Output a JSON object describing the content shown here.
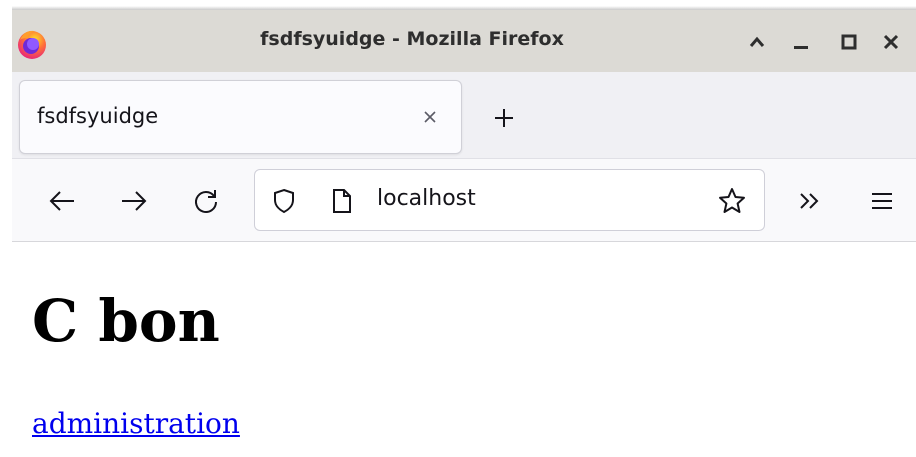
{
  "window": {
    "title": "fsdfsyuidge - Mozilla Firefox"
  },
  "tabs": [
    {
      "title": "fsdfsyuidge",
      "active": true
    }
  ],
  "navbar": {
    "url": "localhost"
  },
  "page": {
    "heading": "C bon",
    "link_text": "administration"
  },
  "colors": {
    "titlebar": "#dcdad5",
    "tabbar": "#f0f0f4",
    "link": "#0000ee"
  },
  "icons": {
    "app": "firefox-logo-icon",
    "back": "arrow-left-icon",
    "forward": "arrow-right-icon",
    "reload": "reload-icon",
    "shield": "shield-icon",
    "page": "page-icon",
    "bookmark": "star-icon",
    "overflow": "chevron-double-right-icon",
    "menu": "hamburger-menu-icon"
  }
}
